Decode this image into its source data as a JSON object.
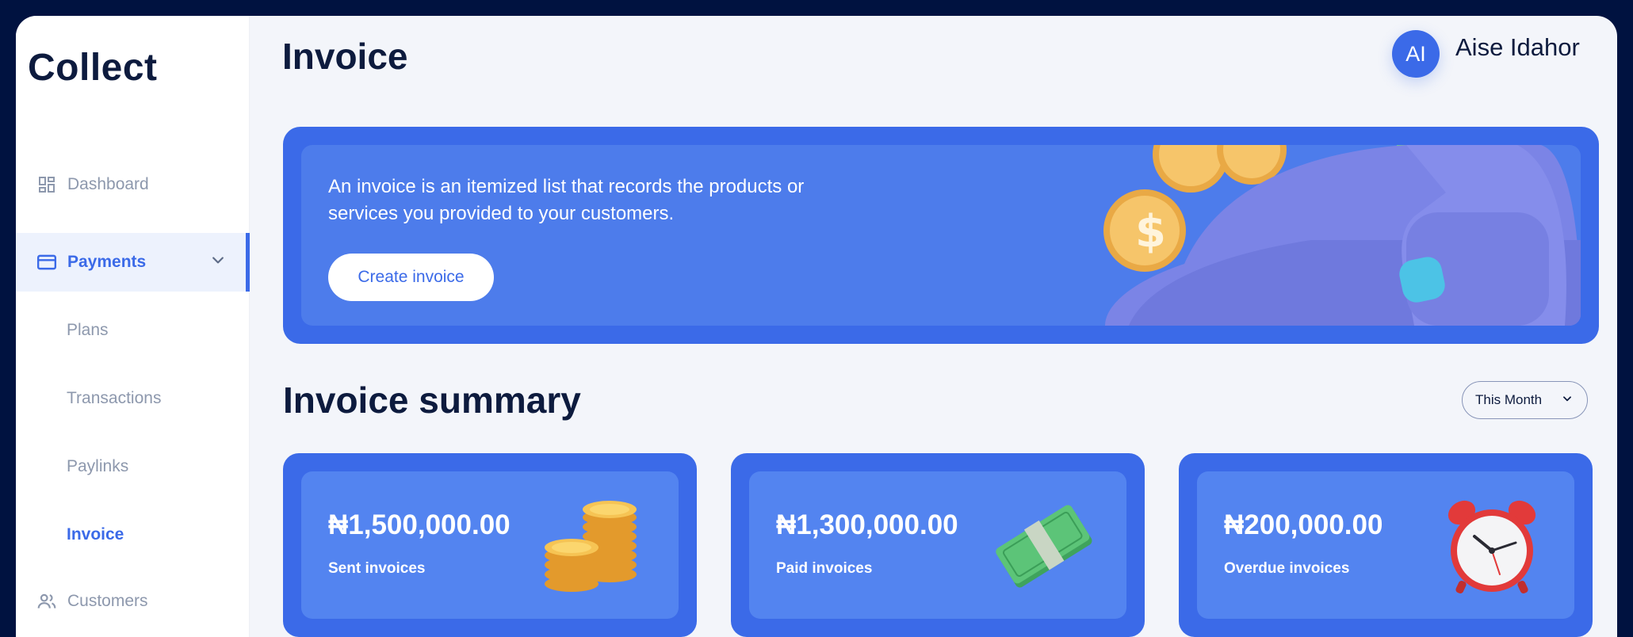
{
  "app": {
    "name": "Collect"
  },
  "header": {
    "title": "Invoice",
    "avatar_initials": "AI",
    "user_name": "Aise Idahor"
  },
  "sidebar": {
    "items": [
      {
        "label": "Dashboard",
        "icon": "dashboard-icon"
      },
      {
        "label": "Payments",
        "icon": "card-icon",
        "active": true,
        "expanded": true
      },
      {
        "label": "Customers",
        "icon": "users-icon"
      }
    ],
    "sub_items": [
      {
        "label": "Plans"
      },
      {
        "label": "Transactions"
      },
      {
        "label": "Paylinks"
      },
      {
        "label": "Invoice",
        "active": true
      }
    ]
  },
  "banner": {
    "text": "An invoice is an itemized list that records the products or services you provided to your customers.",
    "button_label": "Create invoice"
  },
  "summary": {
    "title": "Invoice summary",
    "period": "This Month",
    "cards": [
      {
        "amount": "₦1,500,000.00",
        "label": "Sent invoices",
        "icon": "coins-icon"
      },
      {
        "amount": "₦1,300,000.00",
        "label": "Paid invoices",
        "icon": "cash-icon"
      },
      {
        "amount": "₦200,000.00",
        "label": "Overdue invoices",
        "icon": "alarm-clock-icon"
      }
    ]
  },
  "colors": {
    "accent": "#3b6ae8",
    "navy": "#0d1b3e",
    "background": "#f3f5fa"
  }
}
